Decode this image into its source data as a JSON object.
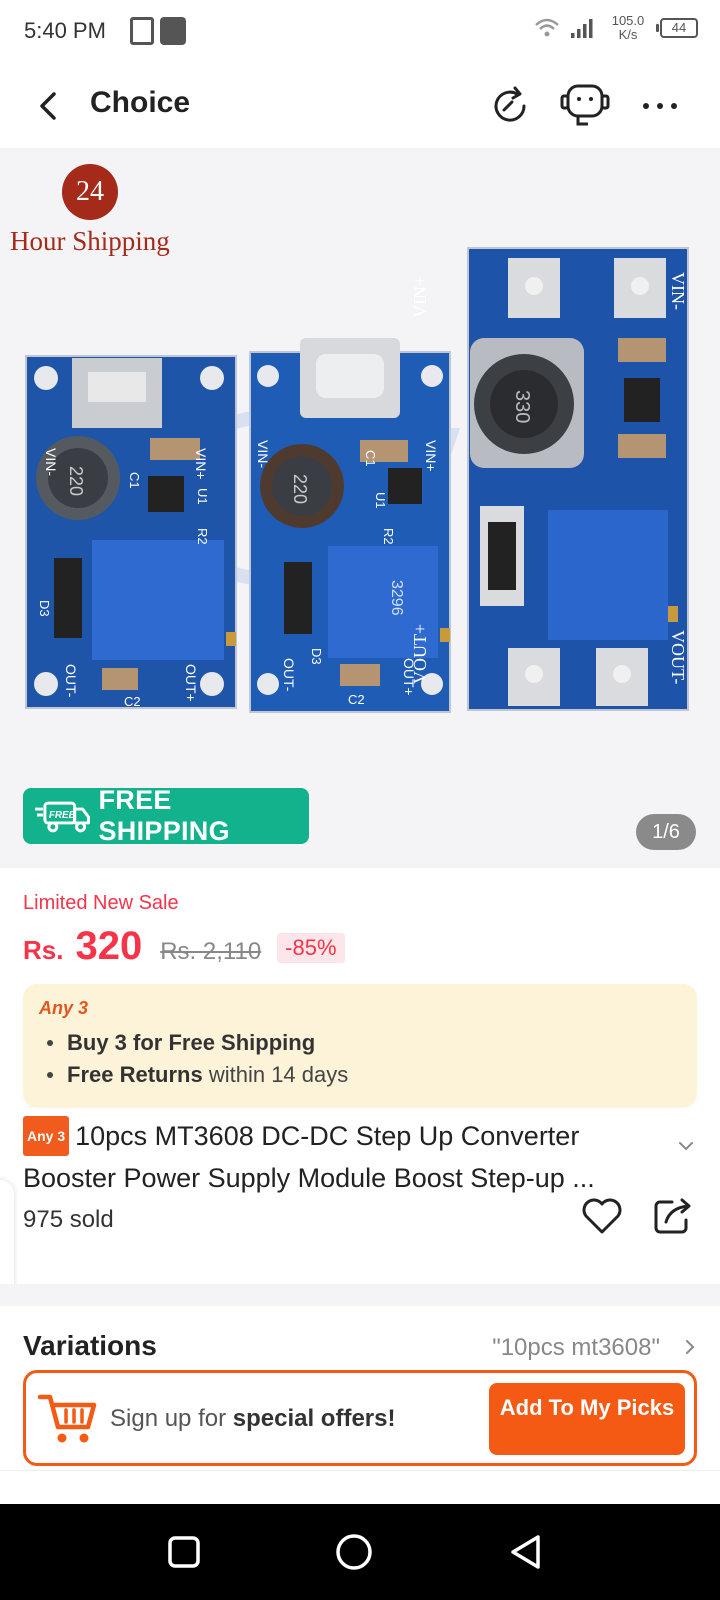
{
  "status_bar": {
    "time": "5:40 PM",
    "net_speed_value": "105.0",
    "net_speed_unit": "K/s",
    "battery": "44"
  },
  "header": {
    "title": "Choice",
    "icons": [
      "back-arrow-icon",
      "refresh-icon",
      "customer-service-icon",
      "more-icon"
    ]
  },
  "product_image": {
    "badge_number": "24",
    "badge_text": "Hour Shipping",
    "free_shipping_tag": "FREE",
    "free_shipping_label": "FREE SHIPPING",
    "page_indicator": "1/6",
    "board_labels": [
      "VIN+",
      "VIN-",
      "VOUT+",
      "VOUT-",
      "OUT+",
      "OUT-",
      "C1",
      "C2",
      "U1",
      "R2",
      "D3",
      "220",
      "330",
      "3296"
    ]
  },
  "price": {
    "sale_label": "Limited New Sale",
    "currency": "Rs.",
    "current": "320",
    "original": "Rs. 2,110",
    "discount": "-85%"
  },
  "offers": {
    "tag": "Any 3",
    "line1_bold": "Buy 3 for  Free Shipping",
    "line2_bold": "Free Returns",
    "line2_rest": " within 14 days"
  },
  "product": {
    "title_tag": "Any 3",
    "title": "10pcs MT3608 DC-DC Step Up Converter Booster Power Supply Module Boost Step-up ...",
    "sold": "975 sold"
  },
  "variations": {
    "title": "Variations",
    "value": "\"10pcs mt3608\""
  },
  "signup_banner": {
    "text_prefix": "Sign up for ",
    "text_bold": "special offers!",
    "button_label": "Add To My Picks"
  },
  "colors": {
    "accent": "#f55a14",
    "price_red": "#f5344a",
    "free_ship_green": "#12b28c",
    "offer_bg": "#fdf3d9"
  }
}
